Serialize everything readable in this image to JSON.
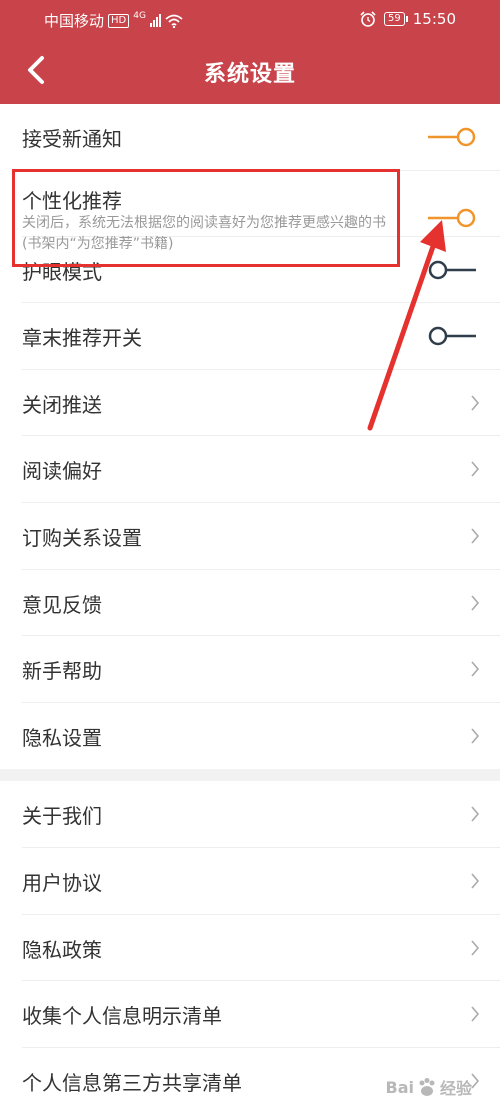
{
  "status_bar": {
    "carrier": "中国移动",
    "hd": "HD",
    "network": "4G",
    "battery": "59",
    "time": "15:50",
    "icons": [
      "signal-icon",
      "wifi-icon",
      "alarm-icon",
      "battery-icon"
    ]
  },
  "nav": {
    "title": "系统设置",
    "back_icon": "chevron-left-icon"
  },
  "settings": {
    "toggles": [
      {
        "label": "接受新通知",
        "on": true
      },
      {
        "label": "个性化推荐",
        "desc": "关闭后，系统无法根据您的阅读喜好为您推荐更感兴趣的书(书架内“为您推荐”书籍)",
        "on": true
      },
      {
        "label": "护眼模式",
        "on": false
      },
      {
        "label": "章末推荐开关",
        "on": false
      }
    ],
    "group1": [
      "关闭推送",
      "阅读偏好",
      "订购关系设置",
      "意见反馈",
      "新手帮助",
      "隐私设置"
    ],
    "group2": [
      "关于我们",
      "用户协议",
      "隐私政策",
      "收集个人信息明示清单",
      "个人信息第三方共享清单"
    ]
  },
  "colors": {
    "header": "#c8434a",
    "toggle_on": "#f0952b",
    "toggle_off": "#2f3e4a",
    "annotation": "#e5322e"
  },
  "watermark": {
    "brand": "Bai",
    "suffix": "经验"
  }
}
